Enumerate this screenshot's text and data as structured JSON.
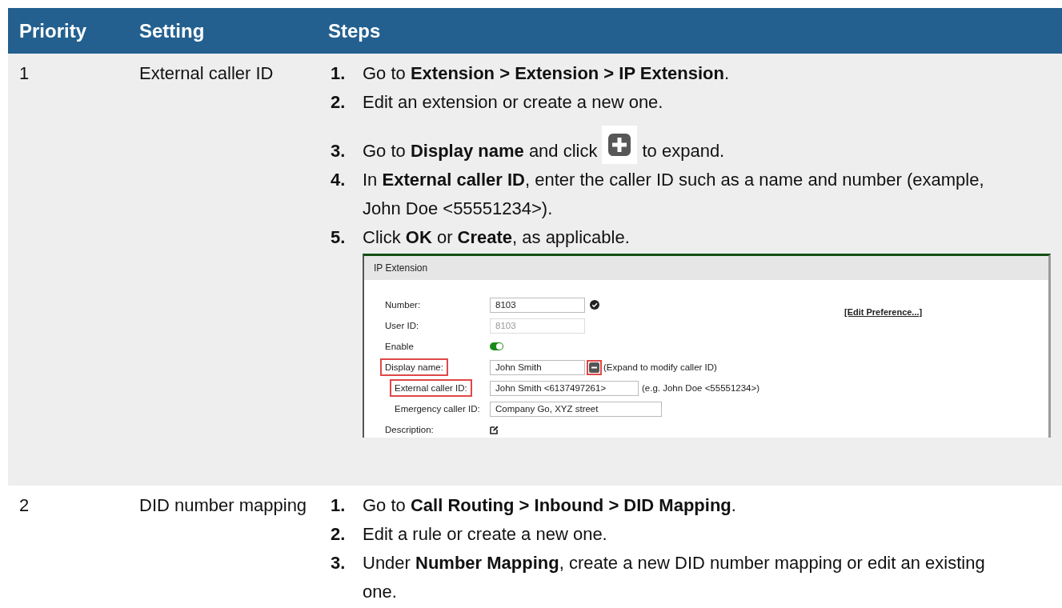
{
  "table": {
    "columns": [
      "Priority",
      "Setting",
      "Steps"
    ],
    "rows": [
      {
        "priority": "1",
        "setting": "External caller ID",
        "steps": [
          {
            "number": "1.",
            "text": "Go to **Extension > Extension > IP Extension**."
          },
          {
            "number": "2.",
            "text": "Edit an extension or create a new one."
          },
          {
            "number": "3.",
            "text": "Go to **Display name** and click",
            "text_after": "to expand."
          },
          {
            "number": "4.",
            "text": "In **External caller ID**, enter the caller ID such as a name and number (example, John Doe <55551234>)."
          },
          {
            "number": "5.",
            "text": "Click **OK** or **Create**, as applicable."
          }
        ],
        "screenshot": {
          "title": "IP Extension",
          "link": "[Edit Preference...]",
          "fields": [
            {
              "kind": "input",
              "label": "Number:",
              "value": "8103",
              "disabled": false,
              "highlighted": false,
              "verified": true
            },
            {
              "kind": "input",
              "label": "User ID:",
              "value": "8103",
              "disabled": true,
              "highlighted": false,
              "verified": false
            },
            {
              "kind": "toggle",
              "label": "Enable",
              "on": true,
              "highlighted": false
            },
            {
              "kind": "expand",
              "label": "Display name:",
              "value": "John Smith",
              "highlighted": true,
              "expanded": true,
              "hint": "(Expand to modify caller ID)",
              "children": [
                {
                  "kind": "input",
                  "label": "External caller ID:",
                  "value": "John Smith <6137497261>",
                  "disabled": false,
                  "highlighted": true,
                  "verified": false,
                  "hint": "(e.g. John Doe <55551234>)"
                },
                {
                  "kind": "input",
                  "label": "Emergency caller ID:",
                  "value": "Company Go, XYZ street",
                  "disabled": false,
                  "highlighted": false,
                  "verified": false
                }
              ]
            },
            {
              "kind": "edit",
              "label": "Description:",
              "highlighted": false
            }
          ]
        }
      },
      {
        "priority": "2",
        "setting": "DID number mapping",
        "steps": [
          {
            "number": "1.",
            "text": "Go to **Call Routing > Inbound > DID Mapping**."
          },
          {
            "number": "2.",
            "text": "Edit a rule or create a new one."
          },
          {
            "number": "3.",
            "text": "Under **Number Mapping**, create a new DID number mapping or edit an existing one."
          }
        ]
      }
    ]
  }
}
